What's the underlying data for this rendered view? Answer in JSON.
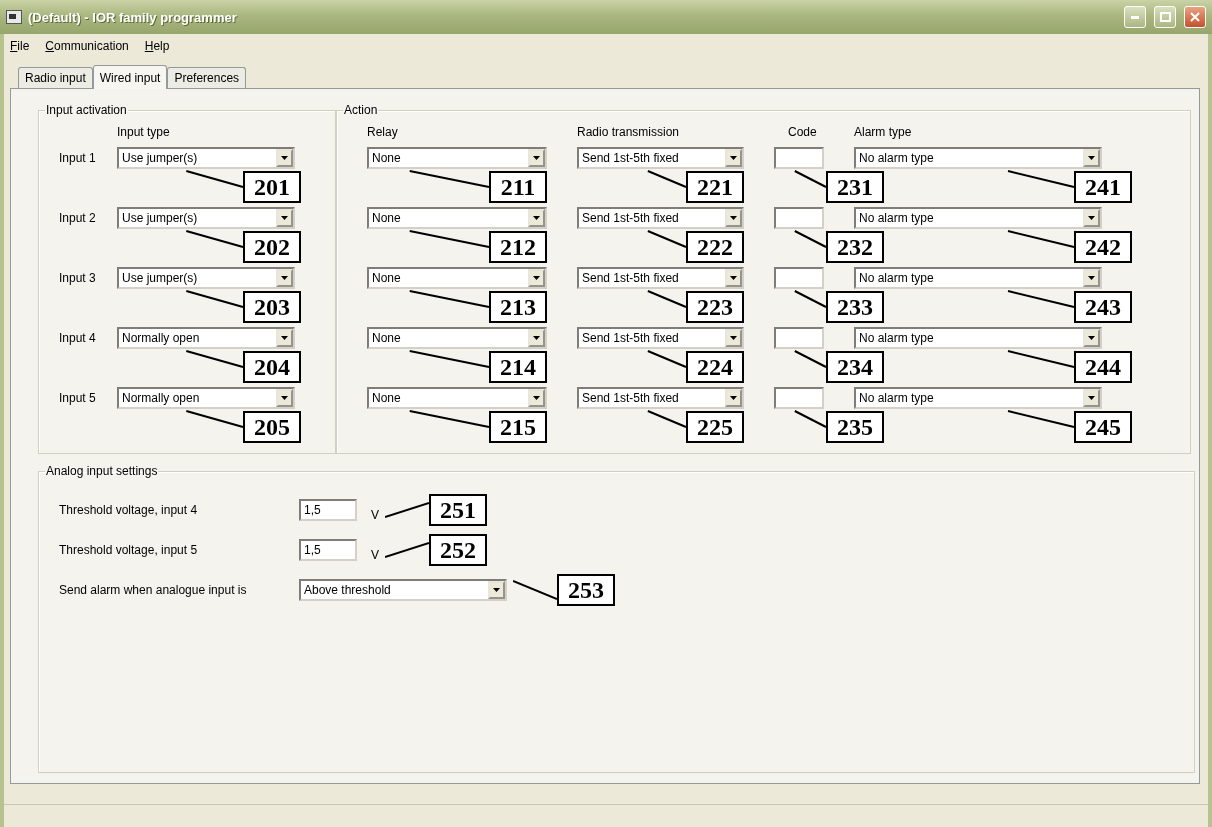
{
  "window": {
    "title": "(Default) - IOR family programmer"
  },
  "menu": [
    "File",
    "Communication",
    "Help"
  ],
  "tabs": [
    {
      "label": "Radio input",
      "selected": false
    },
    {
      "label": "Wired input",
      "selected": true
    },
    {
      "label": "Preferences",
      "selected": false
    }
  ],
  "input_activation": {
    "title": "Input activation",
    "column_header": "Input type",
    "rows": [
      {
        "label": "Input 1",
        "input_type": "Use jumper(s)"
      },
      {
        "label": "Input 2",
        "input_type": "Use jumper(s)"
      },
      {
        "label": "Input 3",
        "input_type": "Use jumper(s)"
      },
      {
        "label": "Input 4",
        "input_type": "Normally open"
      },
      {
        "label": "Input 5",
        "input_type": "Normally open"
      }
    ]
  },
  "action": {
    "title": "Action",
    "columns": [
      "Relay",
      "Radio transmission",
      "Code",
      "Alarm type"
    ],
    "rows": [
      {
        "relay": "None",
        "radio_transmission": "Send 1st-5th fixed",
        "alarm_type": "No alarm type"
      },
      {
        "relay": "None",
        "radio_transmission": "Send 1st-5th fixed",
        "alarm_type": "No alarm type"
      },
      {
        "relay": "None",
        "radio_transmission": "Send 1st-5th fixed",
        "alarm_type": "No alarm type"
      },
      {
        "relay": "None",
        "radio_transmission": "Send 1st-5th fixed",
        "alarm_type": "No alarm type"
      },
      {
        "relay": "None",
        "radio_transmission": "Send 1st-5th fixed",
        "alarm_type": "No alarm type"
      }
    ]
  },
  "analog": {
    "title": "Analog input settings",
    "thresholds": [
      {
        "label": "Threshold voltage, input 4",
        "value": "1,5",
        "unit": "V"
      },
      {
        "label": "Threshold voltage, input 5",
        "value": "1,5",
        "unit": "V"
      }
    ],
    "alarm_when": {
      "label": "Send alarm when analogue input is",
      "value": "Above threshold"
    }
  },
  "callouts": [
    {
      "label": "201"
    },
    {
      "label": "202"
    },
    {
      "label": "203"
    },
    {
      "label": "204"
    },
    {
      "label": "205"
    },
    {
      "label": "211"
    },
    {
      "label": "212"
    },
    {
      "label": "213"
    },
    {
      "label": "214"
    },
    {
      "label": "215"
    },
    {
      "label": "221"
    },
    {
      "label": "222"
    },
    {
      "label": "223"
    },
    {
      "label": "224"
    },
    {
      "label": "225"
    },
    {
      "label": "231"
    },
    {
      "label": "232"
    },
    {
      "label": "233"
    },
    {
      "label": "234"
    },
    {
      "label": "235"
    },
    {
      "label": "241"
    },
    {
      "label": "242"
    },
    {
      "label": "243"
    },
    {
      "label": "244"
    },
    {
      "label": "245"
    },
    {
      "label": "251"
    },
    {
      "label": "252"
    },
    {
      "label": "253"
    }
  ]
}
